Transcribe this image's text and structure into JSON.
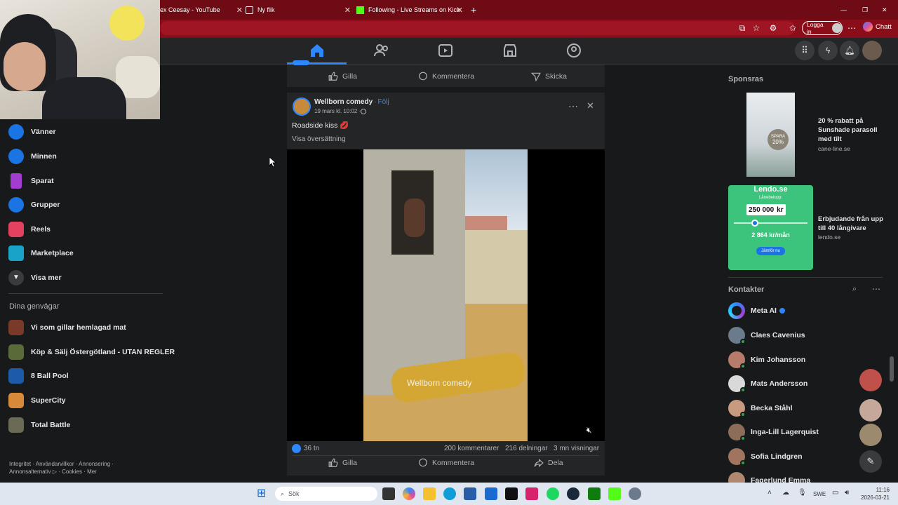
{
  "browser": {
    "tabs": [
      {
        "label": "ex Ceesay - YouTube"
      },
      {
        "label": "Ny flik"
      },
      {
        "label": "Following - Live Streams on Kick"
      }
    ],
    "login_label": "Logga in",
    "chat_label": "Chatt"
  },
  "sidebar": {
    "items": [
      {
        "label": "Vänner",
        "icon": "friends-icon"
      },
      {
        "label": "Minnen",
        "icon": "memories-icon"
      },
      {
        "label": "Sparat",
        "icon": "saved-icon"
      },
      {
        "label": "Grupper",
        "icon": "groups-icon"
      },
      {
        "label": "Reels",
        "icon": "reels-icon"
      },
      {
        "label": "Marketplace",
        "icon": "marketplace-icon"
      },
      {
        "label": "Visa mer",
        "icon": "chevron-down-icon"
      }
    ],
    "shortcuts_heading": "Dina genvägar",
    "shortcuts": [
      {
        "label": "Vi som gillar hemlagad mat"
      },
      {
        "label": "Köp & Sälj Östergötland - UTAN REGLER"
      },
      {
        "label": "8 Ball Pool"
      },
      {
        "label": "SuperCity"
      },
      {
        "label": "Total Battle"
      }
    ],
    "footer_line1": "Integritet · Användarvillkor · Annonsering ·",
    "footer_line2": "Annonsalternativ ▷ · Cookies · Mer"
  },
  "prev_post": {
    "like": "Gilla",
    "comment": "Kommentera",
    "send": "Skicka"
  },
  "post": {
    "author": "Wellborn comedy",
    "follow": "Följ",
    "date": "19 mars kl. 10:02 · ",
    "text": "Roadside kiss 💋",
    "translate": "Visa översättning",
    "watermark": "Wellborn comedy",
    "reactions": "36 tn",
    "comments": "200 kommentarer",
    "shares": "216 delningar",
    "views": "3 mn visningar",
    "like": "Gilla",
    "comment": "Kommentera",
    "share": "Dela"
  },
  "right": {
    "sponsored_heading": "Sponsras",
    "ads": [
      {
        "title": "20 % rabatt på Sunshade parasoll med tilt",
        "domain": "cane-line.se",
        "badge_line1": "SPARA",
        "badge_line2": "20%"
      },
      {
        "title": "Erbjudande från upp till 40 långivare",
        "domain": "lendo.se",
        "brand": "Lendo.se",
        "loan_label": "Lånebelopp:",
        "amount": "250 000",
        "unit": "kr",
        "monthly": "2 864 kr/mån",
        "cta": "Jämför nu"
      }
    ],
    "contacts_heading": "Kontakter",
    "contacts": [
      {
        "name": "Meta AI"
      },
      {
        "name": "Claes Cavenius"
      },
      {
        "name": "Kim Johansson"
      },
      {
        "name": "Mats Andersson"
      },
      {
        "name": "Becka Ståhl"
      },
      {
        "name": "Inga-Lill Lagerquist"
      },
      {
        "name": "Sofia Lindgren"
      },
      {
        "name": "Fagerlund Emma"
      }
    ]
  },
  "taskbar": {
    "search_placeholder": "Sök",
    "lang": "SWE",
    "time": "11:16",
    "date": "2026-03-21"
  },
  "colors": {
    "accent": "#2d88ff",
    "browser_red": "#6e0b14",
    "online": "#31a24c",
    "lendo_green": "#3cc47c"
  }
}
